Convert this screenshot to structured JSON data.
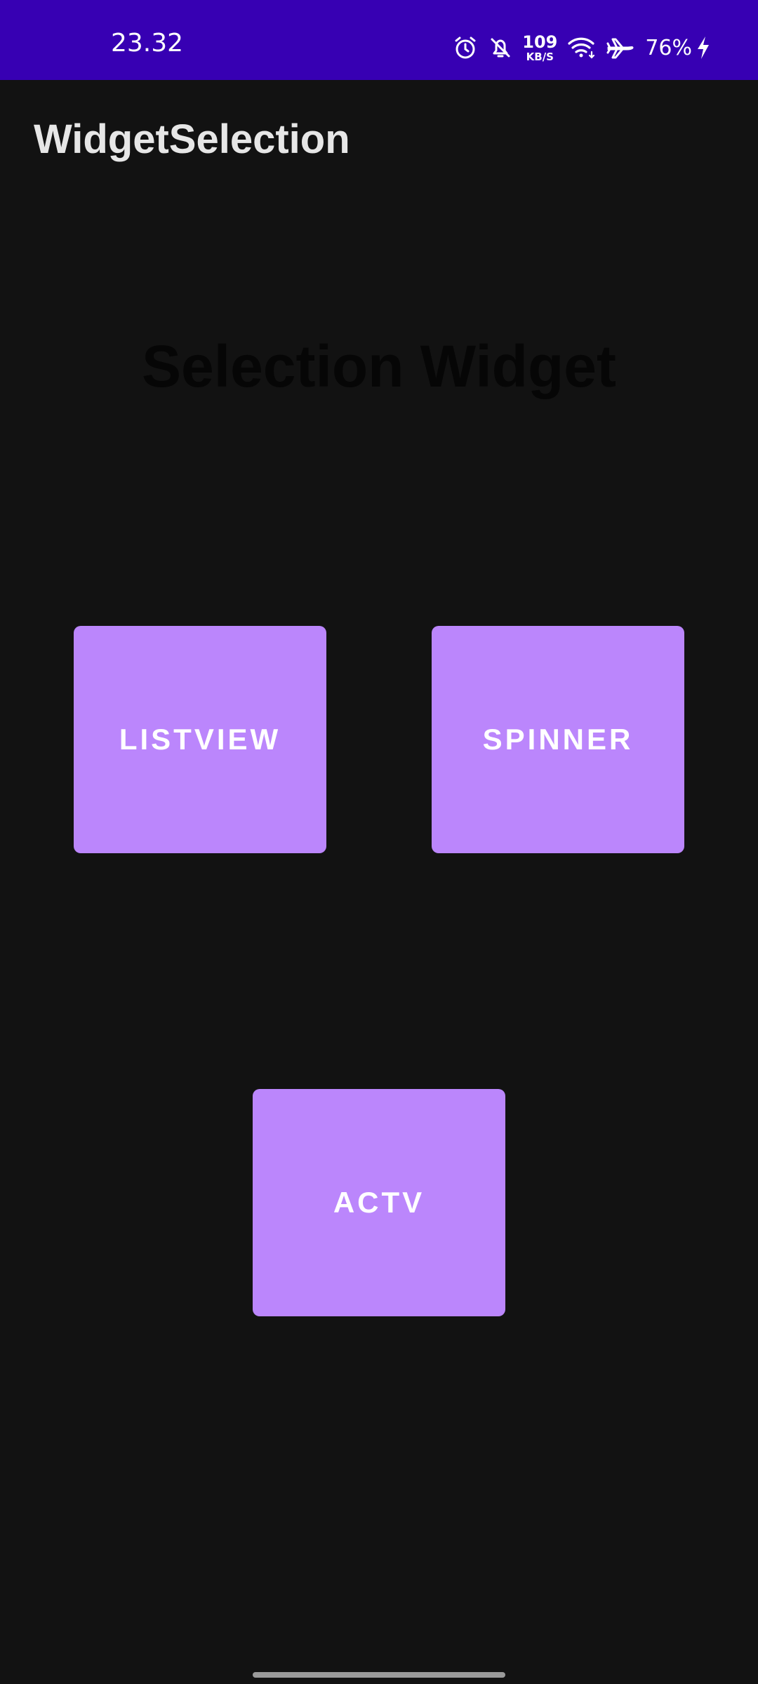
{
  "status_bar": {
    "time": "23.32",
    "network_speed_value": "109",
    "network_speed_unit": "KB/S",
    "battery_percent": "76%",
    "background_color": "#3700B3",
    "icons": [
      "alarm-icon",
      "bell-off-icon",
      "wifi-icon",
      "airplane-icon",
      "charging-bolt-icon"
    ]
  },
  "app_bar": {
    "title": "WidgetSelection"
  },
  "main": {
    "heading": "Selection Widget",
    "buttons": {
      "listview": "LISTVIEW",
      "spinner": "SPINNER",
      "actv": "ACTV"
    },
    "button_color": "#BB86FC"
  },
  "theme": {
    "background": "#121212"
  }
}
